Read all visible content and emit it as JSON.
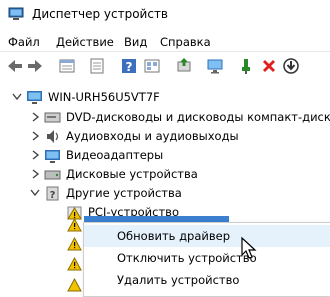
{
  "window": {
    "title": "Диспетчер устройств"
  },
  "menu": [
    "Файл",
    "Действие",
    "Вид",
    "Справка"
  ],
  "toolbar": {
    "icons": [
      "back-icon",
      "forward-icon",
      "properties-icon",
      "list-icon",
      "help-icon",
      "view-icon",
      "update-driver-icon",
      "monitor-icon",
      "enable-device-icon",
      "delete-icon",
      "download-icon"
    ]
  },
  "tree": {
    "root": "WIN-URH56U5VT7F",
    "items": [
      {
        "label": "DVD-дисководы и дисководы компакт-дисков",
        "icon": "dvd-drive-icon"
      },
      {
        "label": "Аудиовходы и аудиовыходы",
        "icon": "audio-icon"
      },
      {
        "label": "Видеоадаптеры",
        "icon": "display-adapter-icon"
      },
      {
        "label": "Дисковые устройства",
        "icon": "disk-drive-icon"
      },
      {
        "label": "Другие устройства",
        "icon": "other-devices-icon"
      }
    ],
    "children": [
      {
        "label": "PCI-устройство",
        "icon": "warning-device-icon"
      }
    ]
  },
  "context_menu": [
    "Обновить драйвер",
    "Отключить устройство",
    "Удалить устройство"
  ],
  "colors": {
    "selection": "#3b7fd1",
    "hover": "#e5f1fb",
    "warning": "#f2c200",
    "delete": "#e01e1e",
    "enable": "#2a8a2a"
  }
}
